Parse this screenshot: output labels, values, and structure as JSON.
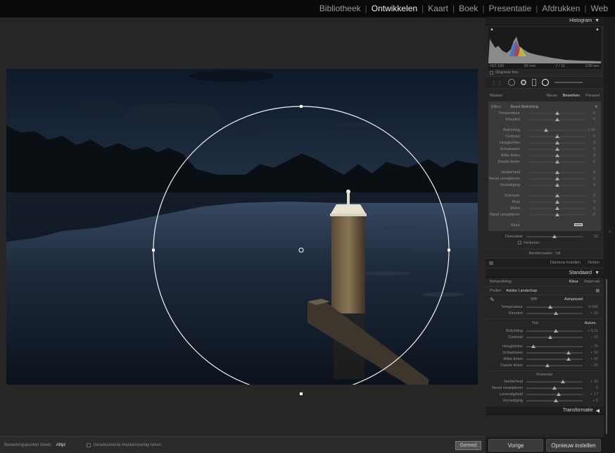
{
  "modules": [
    "Bibliotheek",
    "Ontwikkelen",
    "Kaart",
    "Boek",
    "Presentatie",
    "Afdrukken",
    "Web"
  ],
  "active_module": "Ontwikkelen",
  "histogram": {
    "title": "Histogram",
    "iso": "ISO 100",
    "focal": "30 mm",
    "aperture": "ƒ / 11",
    "shutter": "1/30 sec",
    "original_photo": "Originele foto"
  },
  "mask": {
    "label": "Masker:",
    "new": "Nieuw",
    "edit": "Bewerken",
    "brush": "Penseel",
    "effect_label": "Effect:",
    "effect_value": "Boost Belichting",
    "rows1": [
      {
        "label": "Temperatuur",
        "value": "0",
        "pos": 0.5
      },
      {
        "label": "Kleurtint",
        "value": "0",
        "pos": 0.5
      }
    ],
    "rows2": [
      {
        "label": "Belichting",
        "value": "– 1,40",
        "pos": 0.3
      },
      {
        "label": "Contrast",
        "value": "0",
        "pos": 0.5
      },
      {
        "label": "Hooglichten",
        "value": "0",
        "pos": 0.5
      },
      {
        "label": "Schaduwen",
        "value": "0",
        "pos": 0.5
      },
      {
        "label": "Witte tinten",
        "value": "0",
        "pos": 0.5
      },
      {
        "label": "Zwarte tinten",
        "value": "0",
        "pos": 0.5
      }
    ],
    "rows3": [
      {
        "label": "Helderheid",
        "value": "0",
        "pos": 0.5
      },
      {
        "label": "Nevel verwijderen",
        "value": "0",
        "pos": 0.5
      },
      {
        "label": "Verzadiging",
        "value": "0",
        "pos": 0.5
      }
    ],
    "rows4": [
      {
        "label": "Scherpte",
        "value": "0",
        "pos": 0.5
      },
      {
        "label": "Ruis",
        "value": "0",
        "pos": 0.5
      },
      {
        "label": "Moiré",
        "value": "0",
        "pos": 0.5
      },
      {
        "label": "Rand verwijderen",
        "value": "0",
        "pos": 0.5
      }
    ],
    "color_label": "Kleur",
    "feather_label": "Doezelaar",
    "feather_value": "50",
    "invert_label": "Omkeren",
    "range_mask": "Bereikmasker : Uit",
    "reset": "Opnieuw instellen",
    "close": "Sluiten"
  },
  "basic": {
    "title": "Standaard",
    "treatment_label": "Behandeling:",
    "color": "Kleur",
    "bw": "Zwart-wit",
    "profile_label": "Profiel:",
    "profile_value": "Adobe Landschap",
    "wb_label": "WB:",
    "wb_value": "Aangepast",
    "wb_rows": [
      {
        "label": "Temperatuur",
        "value": "6.000",
        "pos": 0.42
      },
      {
        "label": "Kleurtint",
        "value": "+ 10",
        "pos": 0.52
      }
    ],
    "tone_label": "Tint",
    "auto": "Autom.",
    "tone_rows1": [
      {
        "label": "Belichting",
        "value": "+ 0,11",
        "pos": 0.52
      },
      {
        "label": "Contrast",
        "value": "– 15",
        "pos": 0.43
      }
    ],
    "tone_rows2": [
      {
        "label": "Hooglichten",
        "value": "– 79",
        "pos": 0.12
      },
      {
        "label": "Schaduwen",
        "value": "+ 50",
        "pos": 0.75
      },
      {
        "label": "Witte tinten",
        "value": "+ 50",
        "pos": 0.75
      },
      {
        "label": "Zwarte tinten",
        "value": "– 25",
        "pos": 0.38
      }
    ],
    "presence_label": "Presentie",
    "presence_rows": [
      {
        "label": "Helderheid",
        "value": "+ 30",
        "pos": 0.65
      },
      {
        "label": "Nevel verwijderen",
        "value": "0",
        "pos": 0.5
      },
      {
        "label": "Levendigheid",
        "value": "+ 17",
        "pos": 0.58
      },
      {
        "label": "Verzadiging",
        "value": "+ 5",
        "pos": 0.52
      }
    ]
  },
  "transform_label": "Transformatie",
  "buttons": {
    "previous": "Vorige",
    "reset": "Opnieuw instellen"
  },
  "toolbar": {
    "edit_pins_label": "Bewerkingspunten tonen:",
    "edit_pins_value": "Altijd",
    "overlay_label": "Geselecteerde maskeroverlay tonen",
    "done": "Gereed"
  }
}
